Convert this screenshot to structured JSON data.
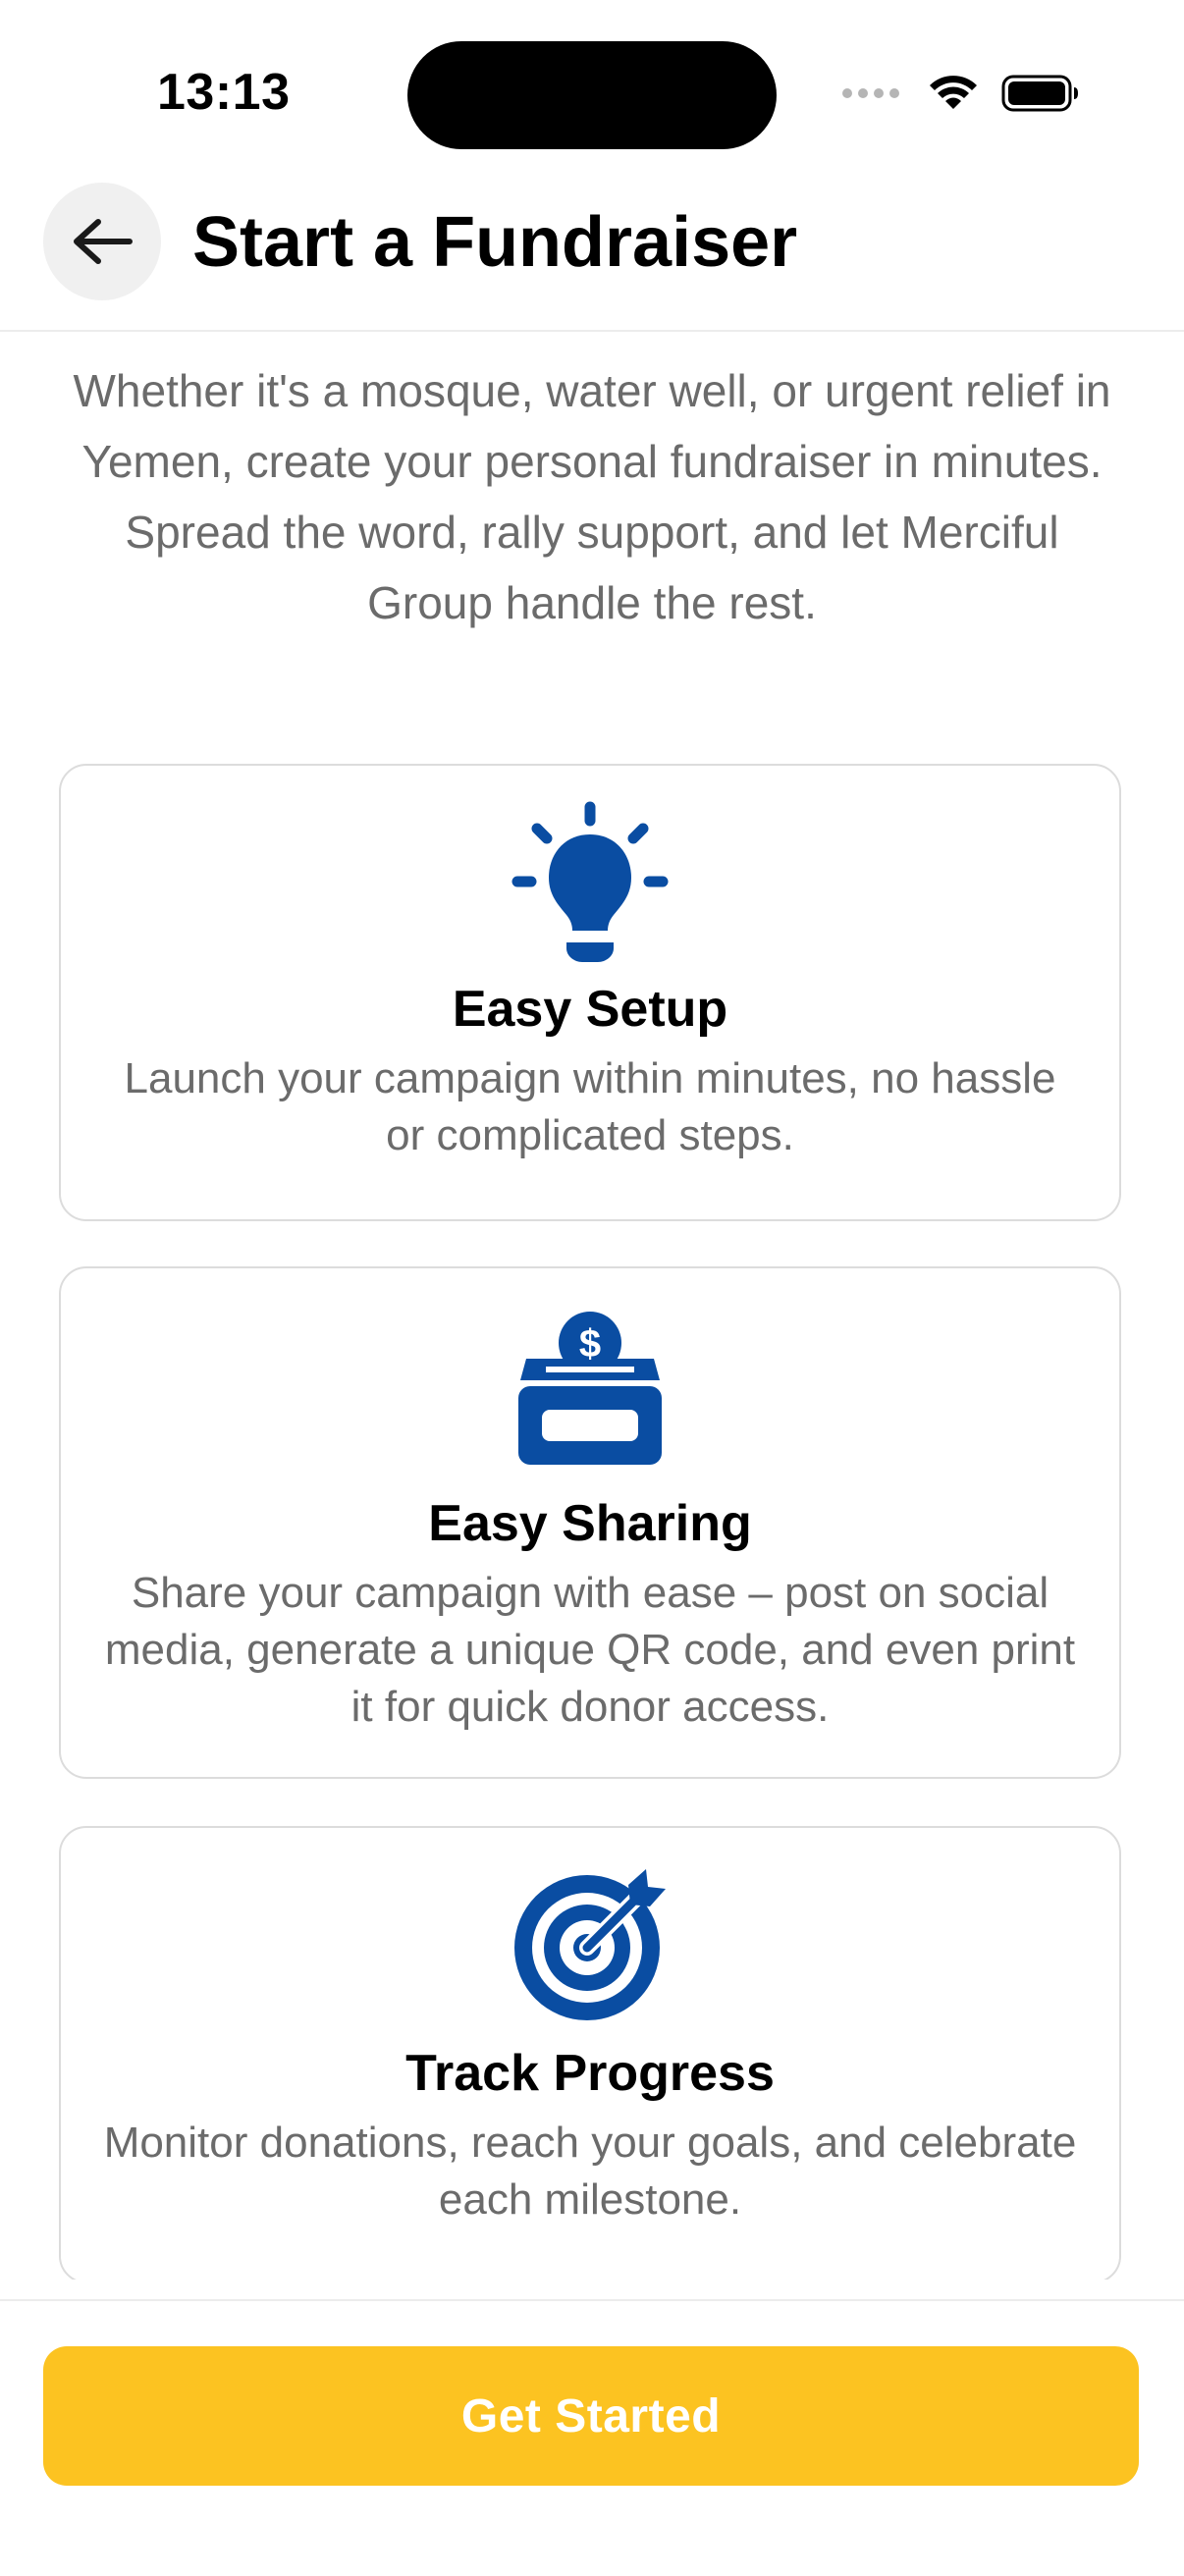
{
  "status_bar": {
    "time": "13:13"
  },
  "header": {
    "title": "Start a Fundraiser"
  },
  "intro": {
    "text": "Whether it's a mosque, water well, or urgent relief in Yemen, create your personal fundraiser in minutes. Spread the word, rally support, and let Merciful Group handle the rest."
  },
  "features": [
    {
      "icon": "lightbulb-icon",
      "title": "Easy Setup",
      "description": "Launch your campaign within minutes, no hassle or complicated steps."
    },
    {
      "icon": "donation-box-icon",
      "title": "Easy Sharing",
      "description": "Share your campaign with ease – post on social media, generate a unique QR code, and even print it for quick donor access."
    },
    {
      "icon": "target-icon",
      "title": "Track Progress",
      "description": "Monitor donations, reach your goals, and celebrate each milestone."
    }
  ],
  "footer": {
    "cta_label": "Get Started"
  },
  "colors": {
    "accent_blue": "#0a4da2",
    "cta_yellow": "#fcc321",
    "text_muted": "#6b6b6b"
  }
}
